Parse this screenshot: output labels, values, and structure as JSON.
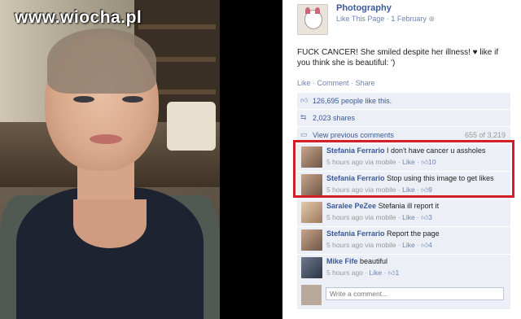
{
  "watermark": "www.wiocha.pl",
  "page": {
    "name": "Photography",
    "like_link": "Like This Page",
    "date": "1 February"
  },
  "post": {
    "text": "FUCK CANCER! She smiled despite her illness! ♥ like if you think she is beautiful: ')"
  },
  "actions": {
    "like": "Like",
    "comment": "Comment",
    "share": "Share"
  },
  "feedback": {
    "likes": "126,695 people like this.",
    "shares": "2,023 shares",
    "view_previous": "View previous comments",
    "count": "655 of 3,219"
  },
  "comments": [
    {
      "name": "Stefania Ferrario",
      "text": "I don't have cancer u assholes",
      "time": "5 hours ago via mobile",
      "like": "Like",
      "likes": "10"
    },
    {
      "name": "Stefania Ferrario",
      "text": "Stop using this image to get likes",
      "time": "5 hours ago via mobile",
      "like": "Like",
      "likes": "9"
    },
    {
      "name": "Saralee PeZee",
      "text": "Stefania ill report it",
      "time": "5 hours ago via mobile",
      "like": "Like",
      "likes": "3"
    },
    {
      "name": "Stefania Ferrario",
      "text": "Report the page",
      "time": "5 hours ago via mobile",
      "like": "Like",
      "likes": "4"
    },
    {
      "name": "Mike Fife",
      "text": "beautiful",
      "time": "5 hours ago",
      "like": "Like",
      "likes": "1"
    }
  ],
  "write_comment": {
    "placeholder": "Write a comment..."
  },
  "colors": {
    "link": "#3b5998",
    "feedback_bg": "#eceff5",
    "highlight": "#d32027"
  },
  "icons": {
    "thumbs_up": "thumbs-up-icon",
    "share": "share-icon",
    "comment": "comment-icon",
    "globe": "globe-icon"
  }
}
